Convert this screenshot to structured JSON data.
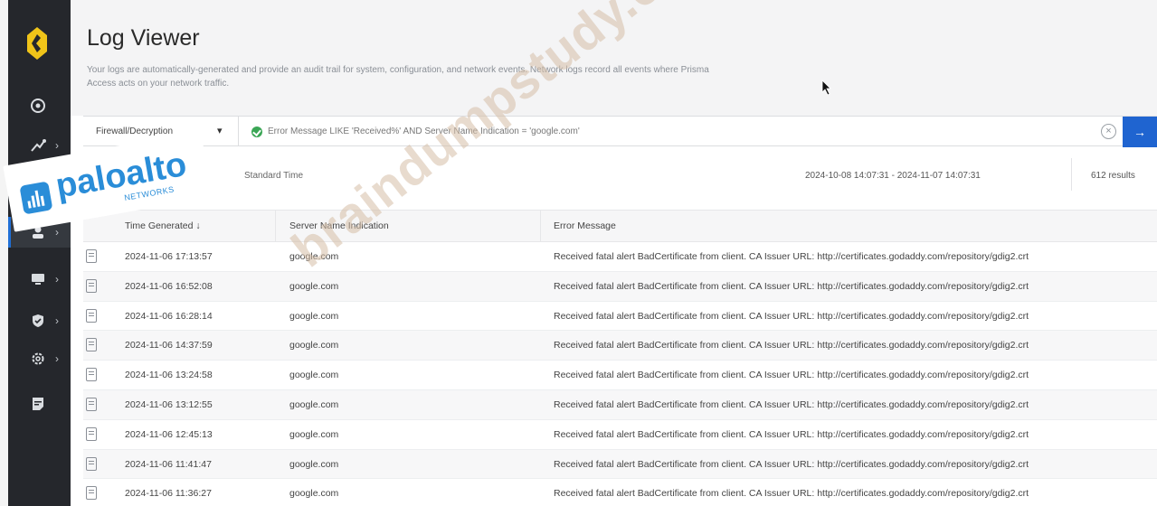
{
  "sidebar": {
    "logo": "logo-icon",
    "items": [
      {
        "icon": "dashboard-icon",
        "chevron": false
      },
      {
        "icon": "connections-icon",
        "chevron": true
      },
      {
        "icon": "user-icon",
        "chevron": true,
        "active": true
      },
      {
        "icon": "monitor-icon",
        "chevron": true
      },
      {
        "icon": "shield-icon",
        "chevron": true
      },
      {
        "icon": "gear-icon",
        "chevron": true
      },
      {
        "icon": "report-icon",
        "chevron": false
      }
    ]
  },
  "header": {
    "title": "Log Viewer",
    "subtitle": "Your logs are automatically-generated and provide an audit trail for system, configuration, and network events. Network logs record all events where Prisma Access acts on your network traffic."
  },
  "filter": {
    "dataset": "Firewall/Decryption",
    "query": "Error Message LIKE 'Received%' AND Server Name Indication = 'google.com'",
    "clear_icon": "close-circle-icon",
    "go_icon": "arrow-right-icon"
  },
  "info": {
    "timezone": "Standard Time",
    "range": "2024-10-08 14:07:31 - 2024-11-07 14:07:31",
    "results": "612 results"
  },
  "table": {
    "columns": [
      "Time Generated ↓",
      "Server Name Indication",
      "Error Message"
    ],
    "rows": [
      [
        "2024-11-06 17:13:57",
        "google.com",
        "Received fatal alert BadCertificate from client. CA Issuer URL: http://certificates.godaddy.com/repository/gdig2.crt"
      ],
      [
        "2024-11-06 16:52:08",
        "google.com",
        "Received fatal alert BadCertificate from client. CA Issuer URL: http://certificates.godaddy.com/repository/gdig2.crt"
      ],
      [
        "2024-11-06 16:28:14",
        "google.com",
        "Received fatal alert BadCertificate from client. CA Issuer URL: http://certificates.godaddy.com/repository/gdig2.crt"
      ],
      [
        "2024-11-06 14:37:59",
        "google.com",
        "Received fatal alert BadCertificate from client. CA Issuer URL: http://certificates.godaddy.com/repository/gdig2.crt"
      ],
      [
        "2024-11-06 13:24:58",
        "google.com",
        "Received fatal alert BadCertificate from client. CA Issuer URL: http://certificates.godaddy.com/repository/gdig2.crt"
      ],
      [
        "2024-11-06 13:12:55",
        "google.com",
        "Received fatal alert BadCertificate from client. CA Issuer URL: http://certificates.godaddy.com/repository/gdig2.crt"
      ],
      [
        "2024-11-06 12:45:13",
        "google.com",
        "Received fatal alert BadCertificate from client. CA Issuer URL: http://certificates.godaddy.com/repository/gdig2.crt"
      ],
      [
        "2024-11-06 11:41:47",
        "google.com",
        "Received fatal alert BadCertificate from client. CA Issuer URL: http://certificates.godaddy.com/repository/gdig2.crt"
      ],
      [
        "2024-11-06 11:36:27",
        "google.com",
        "Received fatal alert BadCertificate from client. CA Issuer URL: http://certificates.godaddy.com/repository/gdig2.crt"
      ]
    ]
  },
  "overlays": {
    "watermark": "braindumpstudy.com",
    "brand_word": "paloalto",
    "brand_sub": "NETWORKS"
  },
  "colors": {
    "sidebar": "#25272c",
    "accent": "#1f64d0",
    "success": "#3aa655",
    "brand": "#2a8dd8"
  }
}
